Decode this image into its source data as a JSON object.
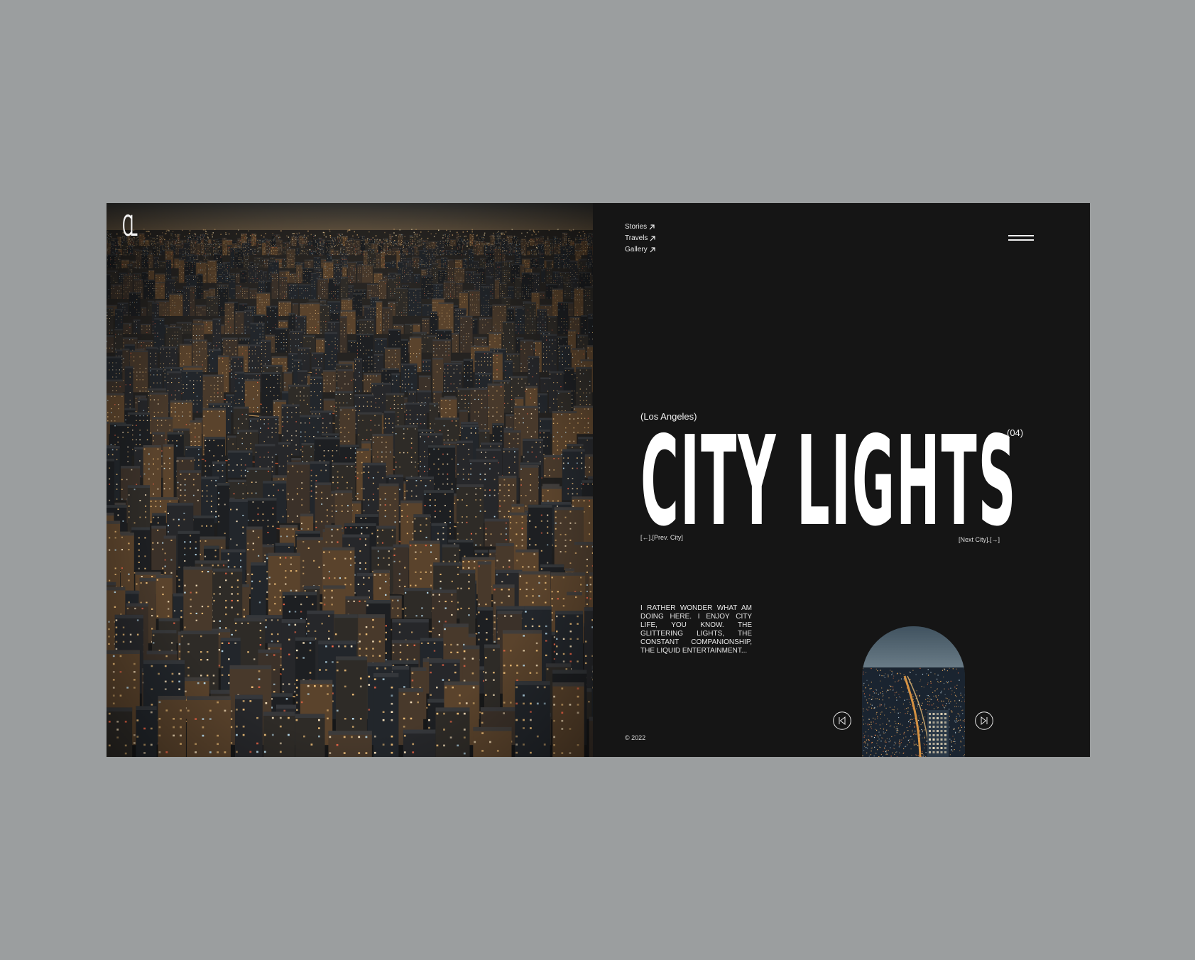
{
  "brand": {
    "logo": "CL"
  },
  "nav": {
    "items": [
      {
        "label": "Stories"
      },
      {
        "label": "Travels"
      },
      {
        "label": "Gallery"
      }
    ]
  },
  "hero": {
    "city_name": "(Los Angeles)",
    "title": "CITY LIGHTS",
    "count": "(04)",
    "prev_label": "[←].[Prev. City]",
    "next_label": "[Next City].[→]",
    "description": "I rather wonder what am doing here. I enjoy city life, you know. The glittering lights, the constant companionship, the liquid entertainment..."
  },
  "footer": {
    "copyright": "© 2022"
  },
  "icons": {
    "nav_arrow": "arrow-up-right-icon",
    "menu": "hamburger-menu-icon",
    "prev": "skip-back-icon",
    "next": "skip-forward-icon"
  },
  "colors": {
    "page_background": "#9b9e9f",
    "panel_background": "#151515",
    "text": "#ffffff"
  }
}
